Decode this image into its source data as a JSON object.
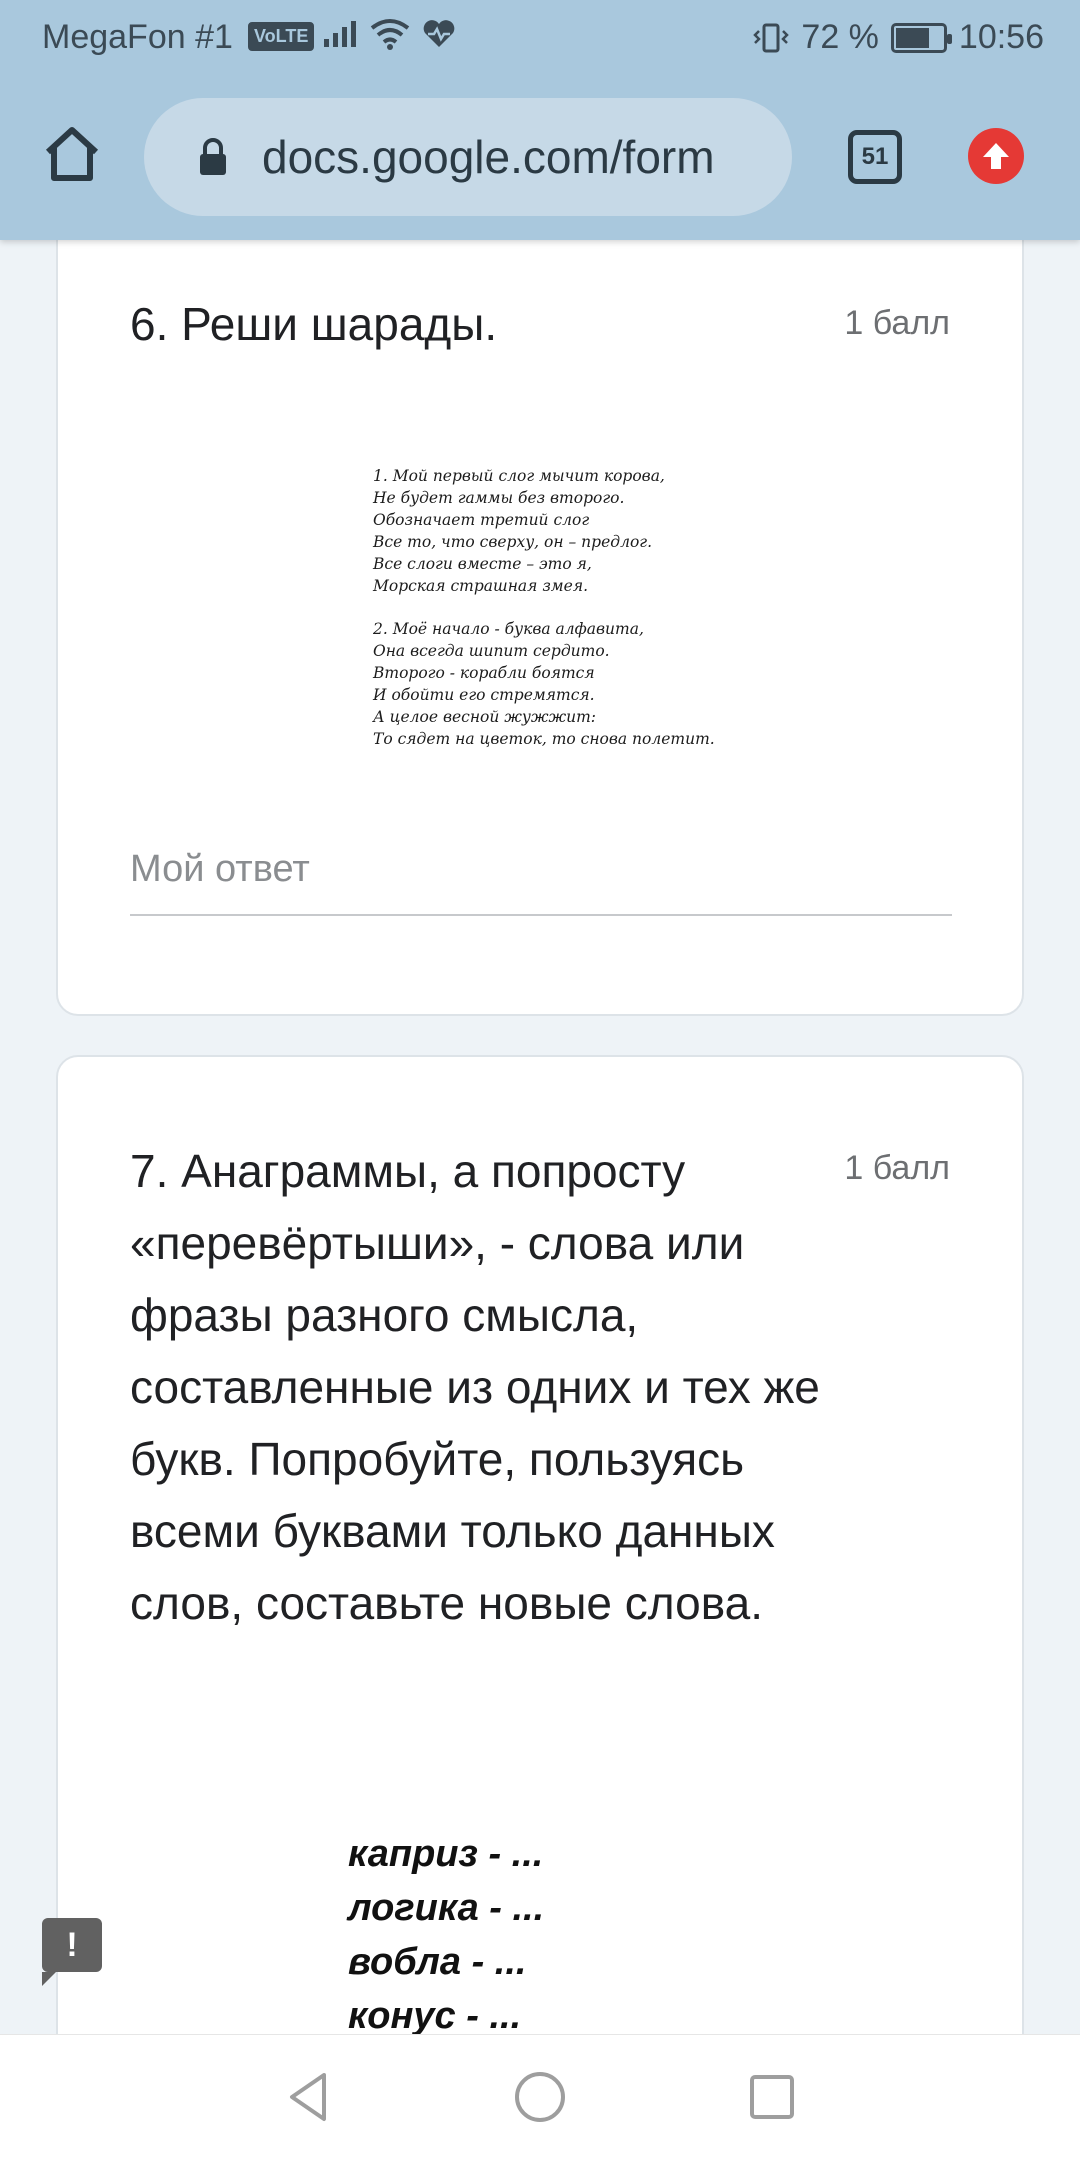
{
  "status_bar": {
    "carrier": "MegaFon #1",
    "volte": "VoLTE",
    "battery": "72 %",
    "battery_level": 0.72,
    "time": "10:56",
    "icons": [
      "signal-icon",
      "wifi-icon",
      "heart-rate-icon",
      "vibrate-icon"
    ]
  },
  "browser": {
    "url": "docs.google.com/form",
    "tab_count": "51",
    "icons": [
      "home-icon",
      "lock-icon",
      "tabs-icon",
      "update-arrow-icon"
    ]
  },
  "question6": {
    "title": "6. Реши шарады.",
    "points": "1 балл",
    "image_text": {
      "riddle1": [
        "1. Мой первый слог мычит корова,",
        "Не будет гаммы без второго.",
        "Обозначает третий слог",
        "Все то, что сверху, он – предлог.",
        "Все слоги вместе – это я,",
        "Морская страшная змея."
      ],
      "riddle2": [
        "2. Моё начало - буква алфавита,",
        "Она всегда шипит сердито.",
        "Второго - корабли боятся",
        "И обойти его стремятся.",
        "А целое весной жужжит:",
        "То сядет на цветок, то снова полетит."
      ]
    },
    "answer_placeholder": "Мой ответ"
  },
  "question7": {
    "title": "7. Анаграммы, а попросту «перевёртыши», - слова или фразы разного смысла, составленные из одних и тех же букв. Попробуйте, пользуясь всеми буквами только данных слов, составьте новые слова.",
    "points": "1 балл",
    "words": [
      "каприз - ...",
      "логика -  ...",
      "вобла -  ...",
      "конус -  ..."
    ]
  },
  "feedback_button": "!",
  "nav": [
    "back-icon",
    "home-circle-icon",
    "recents-icon"
  ]
}
